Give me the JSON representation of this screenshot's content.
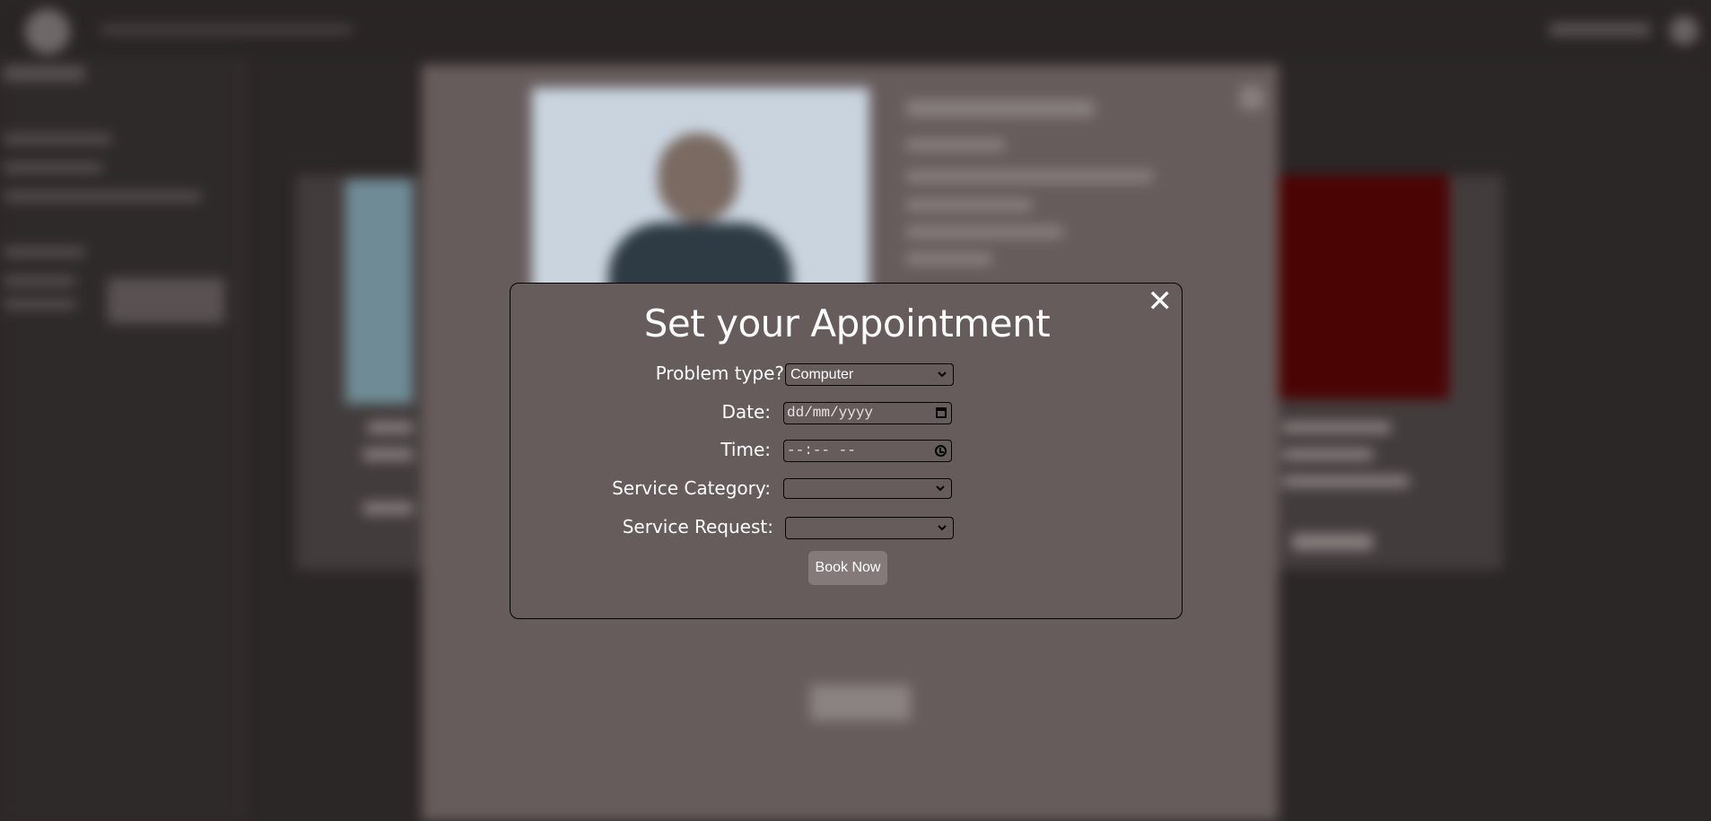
{
  "modal": {
    "close_label": "✕",
    "title": "Set your Appointment",
    "problem_type_label": "Problem type?",
    "problem_type_value": "Computer",
    "date_label": "Date:",
    "date_placeholder": "dd/mm/yyyy",
    "time_label": "Time:",
    "time_placeholder": "--:-- --",
    "service_category_label": "Service Category:",
    "service_category_value": "",
    "service_request_label": "Service Request:",
    "service_request_value": "",
    "submit_label": "Book Now"
  },
  "colors": {
    "page_background": "#2c2727",
    "modal_background": "#675c5c",
    "button_background": "#857a7a",
    "text": "#ffffff"
  },
  "icons": [
    "close-icon",
    "chevron-down-icon",
    "calendar-icon",
    "clock-icon"
  ]
}
